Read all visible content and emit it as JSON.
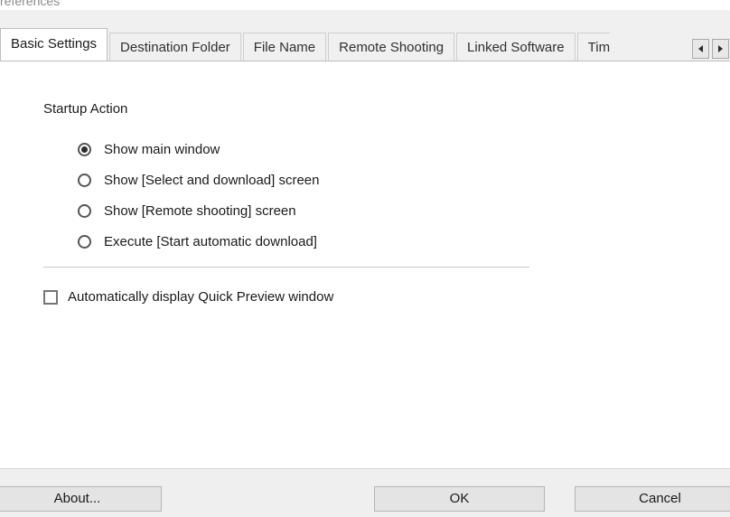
{
  "window": {
    "title": "references"
  },
  "tabs": {
    "items": [
      {
        "label": "Basic Settings",
        "active": true
      },
      {
        "label": "Destination Folder",
        "active": false
      },
      {
        "label": "File Name",
        "active": false
      },
      {
        "label": "Remote Shooting",
        "active": false
      },
      {
        "label": "Linked Software",
        "active": false
      },
      {
        "label": "Tim",
        "active": false
      }
    ],
    "scroll_left_icon": "triangle-left-icon",
    "scroll_right_icon": "triangle-right-icon"
  },
  "basic_settings": {
    "group_label": "Startup Action",
    "radio_options": [
      {
        "label": "Show main window",
        "selected": true
      },
      {
        "label": "Show [Select and download] screen",
        "selected": false
      },
      {
        "label": "Show [Remote shooting] screen",
        "selected": false
      },
      {
        "label": "Execute [Start automatic download]",
        "selected": false
      }
    ],
    "checkbox": {
      "label": "Automatically display Quick Preview window",
      "checked": false
    }
  },
  "footer": {
    "about_label": "About...",
    "ok_label": "OK",
    "cancel_label": "Cancel"
  },
  "colors": {
    "content_bg": "#ffffff",
    "chrome_bg": "#f0f0f0",
    "footer_bg": "#efefef",
    "border": "#bdbdbd",
    "text": "#1a1a1a"
  }
}
